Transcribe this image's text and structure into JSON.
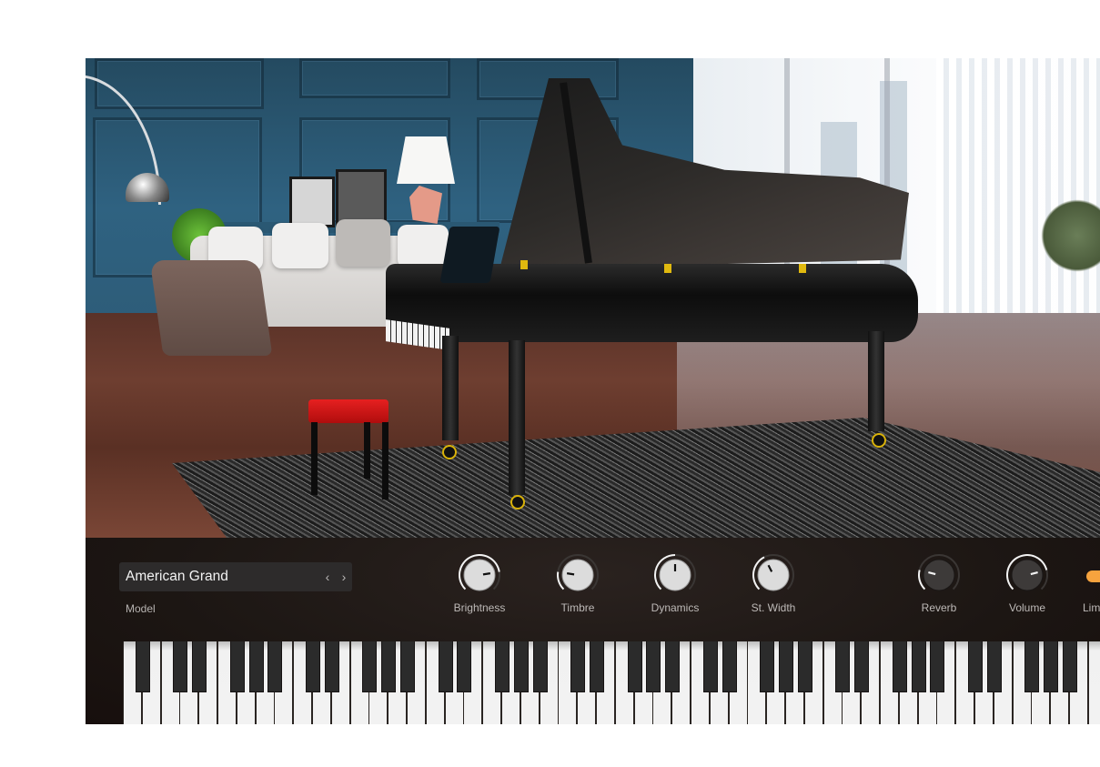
{
  "scene": {
    "description": "grand piano in living room",
    "bench_color": "#e02020"
  },
  "panel": {
    "model": {
      "value": "American Grand",
      "label": "Model",
      "prev_icon": "‹",
      "next_icon": "›"
    },
    "knobs": [
      {
        "id": "brightness",
        "label": "Brightness",
        "value": 0.8,
        "style": "light"
      },
      {
        "id": "timbre",
        "label": "Timbre",
        "value": 0.2,
        "style": "light"
      },
      {
        "id": "dynamics",
        "label": "Dynamics",
        "value": 0.5,
        "style": "light"
      },
      {
        "id": "st-width",
        "label": "St. Width",
        "value": 0.4,
        "style": "light"
      },
      {
        "id": "reverb",
        "label": "Reverb",
        "value": 0.22,
        "style": "dark"
      },
      {
        "id": "volume",
        "label": "Volume",
        "value": 0.78,
        "style": "dark"
      }
    ],
    "limiter": {
      "label": "Lim",
      "on": true,
      "color": "#f7a33e"
    }
  },
  "keyboard": {
    "first_note": "A0",
    "visible_white_keys": 52
  }
}
